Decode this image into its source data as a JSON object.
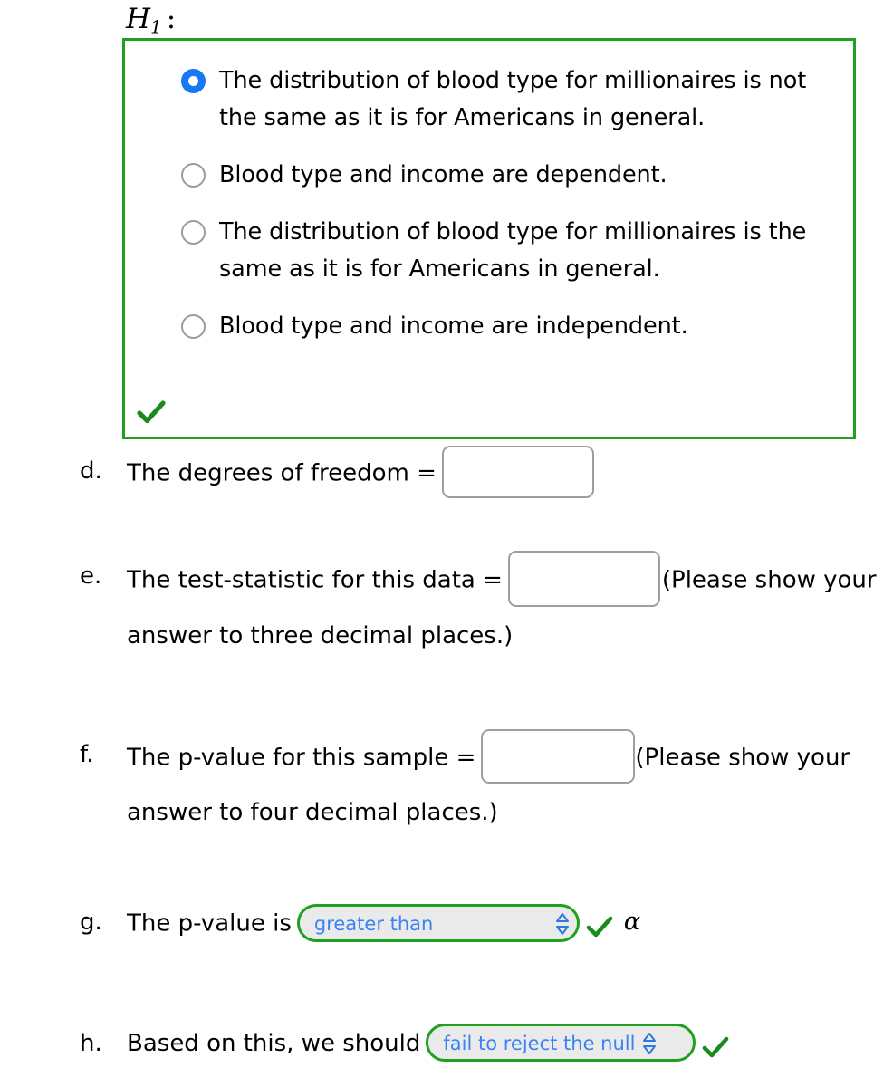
{
  "hypothesis": {
    "symbol": "H",
    "subscript": "1",
    "colon": ":"
  },
  "answer_box": {
    "border_color": "#1fa01f",
    "check_color": "#1a8a1a",
    "check_icon": "check-icon",
    "options": [
      {
        "id": "opt-1",
        "label": "The distribution of blood type for millionaires is not the same as it is for Americans in general.",
        "selected": true,
        "selected_color": "#1877f2"
      },
      {
        "id": "opt-2",
        "label": "Blood type and income are dependent.",
        "selected": false
      },
      {
        "id": "opt-3",
        "label": "The distribution of blood type for millionaires is the same as it is for Americans in general.",
        "selected": false
      },
      {
        "id": "opt-4",
        "label": "Blood type and income are independent.",
        "selected": false
      }
    ]
  },
  "questions": {
    "d": {
      "marker": "d.",
      "text_before": "The degrees of freedom =",
      "input_value": "",
      "input_placeholder": ""
    },
    "e": {
      "marker": "e.",
      "text_before": "The test-statistic for this data =",
      "input_value": "",
      "input_placeholder": "",
      "text_after": "(Please show your answer to three decimal places.)"
    },
    "f": {
      "marker": "f.",
      "text_before": "The p-value for this sample =",
      "input_value": "",
      "input_placeholder": "",
      "text_after": "(Please show your answer to four decimal places.)"
    },
    "g": {
      "marker": "g.",
      "text_before": "The p-value is",
      "select_value": "greater than",
      "chevron_icon": "chevron-up-down-icon",
      "check_icon": "check-icon",
      "alpha_symbol": "α"
    },
    "h": {
      "marker": "h.",
      "text_before": "Based on this, we should",
      "select_value": "fail to reject the null",
      "chevron_icon": "chevron-up-down-icon",
      "check_icon": "check-icon"
    }
  },
  "colors": {
    "green": "#1fa01f",
    "blue_radio": "#1877f2",
    "blue_text": "#3b82f6",
    "gray_border": "#9e9e9e",
    "pill_bg": "#eaeaea"
  }
}
